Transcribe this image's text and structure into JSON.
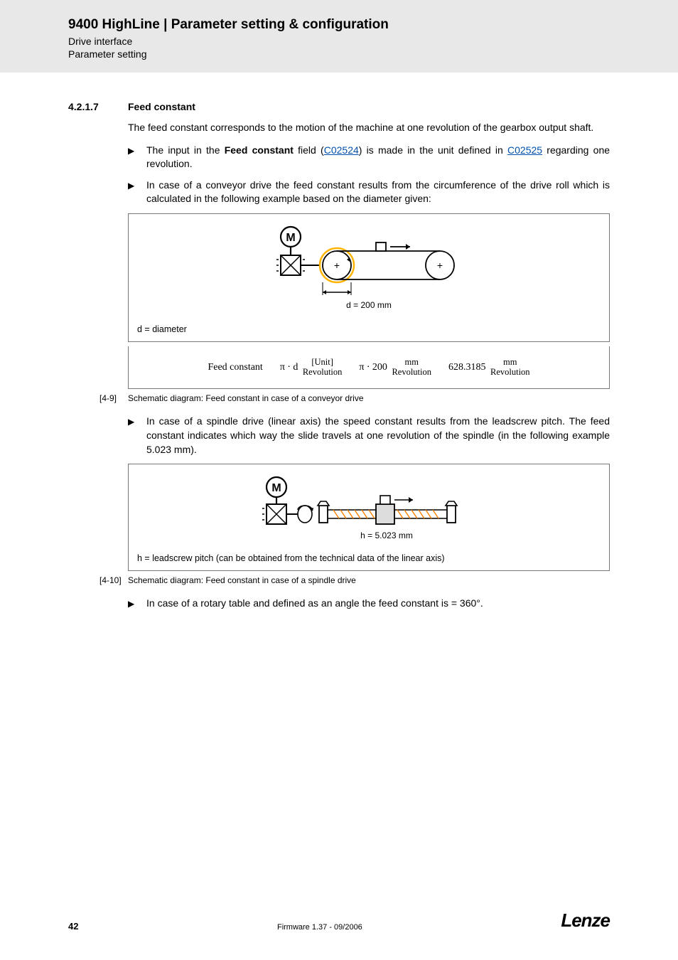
{
  "header": {
    "title": "9400 HighLine | Parameter setting & configuration",
    "sub1": "Drive interface",
    "sub2": "Parameter setting"
  },
  "section": {
    "num": "4.2.1.7",
    "title": "Feed constant"
  },
  "para1": "The feed constant corresponds to the motion of the machine at one revolution of the gearbox output shaft.",
  "b1_pre": "The input in the ",
  "b1_field": "Feed constant",
  "b1_mid1": " field (",
  "b1_link1": "C02524",
  "b1_mid2": ")  is made in the unit defined in ",
  "b1_link2": "C02525",
  "b1_post": " regarding one revolution.",
  "b2": "In case of a conveyor drive the feed constant results from the circumference of the drive roll which is calculated in the following example based on the diameter given:",
  "fig1": {
    "d_label": "d = 200 mm",
    "legend": "d = diameter",
    "motor_label": "M"
  },
  "formula": {
    "label": "Feed constant",
    "t1a": "π ⋅ d",
    "t1_top": "[Unit]",
    "t1_bot": "Revolution",
    "t2a": "π ⋅ 200",
    "t2_top": "mm",
    "t2_bot": "Revolution",
    "t3a": "628.3185",
    "t3_top": "mm",
    "t3_bot": "Revolution"
  },
  "cap1": {
    "num": "[4-9]",
    "text": "Schematic diagram: Feed constant in case of a conveyor drive"
  },
  "b3": "In case of a spindle drive (linear axis) the speed constant results from the leadscrew pitch. The feed constant indicates which way the slide travels at one revolution of the spindle (in the following example 5.023 mm).",
  "fig2": {
    "h_label": "h = 5.023 mm",
    "legend": "h = leadscrew pitch (can be obtained from the technical data of the linear axis)",
    "motor_label": "M"
  },
  "cap2": {
    "num": "[4-10]",
    "text": "Schematic diagram: Feed constant in case of a spindle drive"
  },
  "b4": "In case of a rotary table and defined as an angle the feed constant is = 360°.",
  "footer": {
    "page": "42",
    "fw": "Firmware 1.37 - 09/2006",
    "logo": "Lenze"
  }
}
